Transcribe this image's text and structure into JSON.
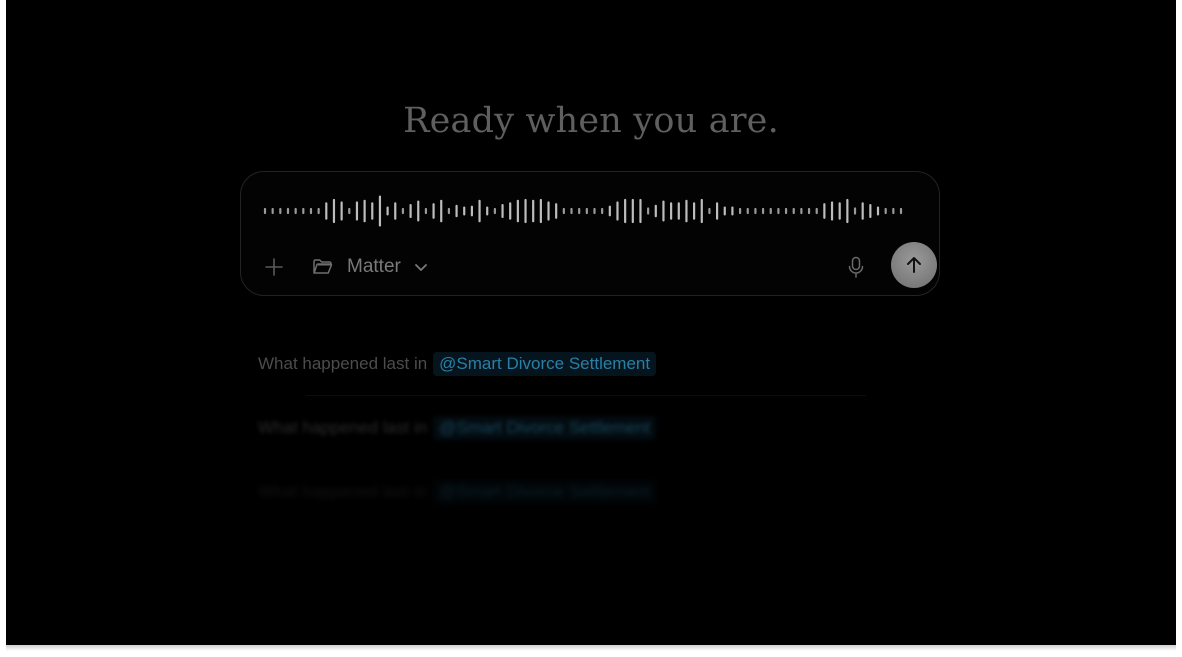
{
  "headline": "Ready when you are.",
  "composer": {
    "waveform_levels": [
      0.12,
      0.12,
      0.12,
      0.12,
      0.12,
      0.12,
      0.12,
      0.12,
      0.45,
      0.65,
      0.5,
      0.12,
      0.5,
      0.6,
      0.45,
      0.85,
      0.2,
      0.45,
      0.12,
      0.35,
      0.55,
      0.12,
      0.4,
      0.6,
      0.12,
      0.3,
      0.2,
      0.25,
      0.6,
      0.2,
      0.12,
      0.35,
      0.45,
      0.6,
      0.65,
      0.6,
      0.65,
      0.5,
      0.4,
      0.12,
      0.12,
      0.12,
      0.12,
      0.12,
      0.12,
      0.25,
      0.5,
      0.65,
      0.65,
      0.65,
      0.15,
      0.3,
      0.55,
      0.45,
      0.45,
      0.6,
      0.45,
      0.65,
      0.12,
      0.45,
      0.2,
      0.2,
      0.12,
      0.12,
      0.12,
      0.12,
      0.12,
      0.12,
      0.12,
      0.12,
      0.12,
      0.12,
      0.12,
      0.4,
      0.5,
      0.45,
      0.65,
      0.15,
      0.45,
      0.35,
      0.2,
      0.12,
      0.12,
      0.12
    ],
    "plus_icon": "plus-icon",
    "matter": {
      "label": "Matter",
      "icon": "folder-icon",
      "dropdown_icon": "chevron-down-icon"
    },
    "mic_icon": "microphone-icon",
    "send_icon": "arrow-up-icon"
  },
  "suggestions": [
    {
      "prefix": "What happened last in",
      "tag": "@Smart Divorce Settlement"
    },
    {
      "prefix": "What happened last in",
      "tag": "@Smart Divorce Settlement"
    },
    {
      "prefix": "What happened last in",
      "tag": "@Smart Divorce Settlement"
    }
  ],
  "colors": {
    "background": "#000000",
    "tag_text": "#2a7fa6",
    "send_button": "#8a8a8a"
  }
}
